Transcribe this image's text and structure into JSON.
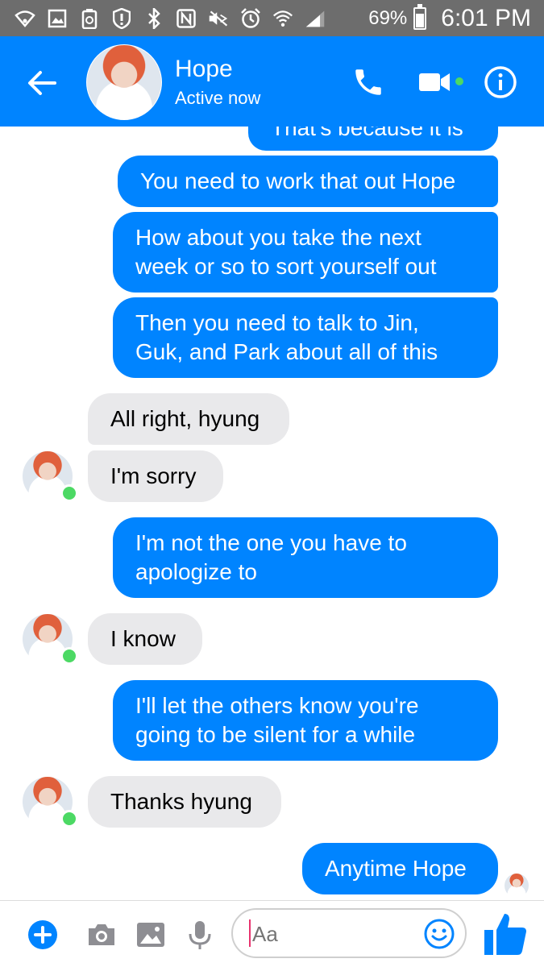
{
  "status_bar": {
    "battery_percent": "69%",
    "time": "6:01 PM",
    "battery_level": 0.69,
    "icons": [
      "wifi-icon",
      "gallery-icon",
      "recycle-icon",
      "shield-alert-icon",
      "bluetooth-icon",
      "nfc-icon",
      "mute-icon",
      "alarm-icon",
      "wifi-signal-icon",
      "cell-signal-icon"
    ]
  },
  "header": {
    "contact_name": "Hope",
    "status": "Active now",
    "accent_color": "#0084ff"
  },
  "messages": [
    {
      "dir": "out",
      "text": "That's because it is"
    },
    {
      "dir": "out",
      "text": "You need to work that out Hope"
    },
    {
      "dir": "out",
      "text": "How about you take the next\nweek or so to sort yourself out"
    },
    {
      "dir": "out",
      "text": "Then you need to talk to Jin,\nGuk, and Park about all of this"
    },
    {
      "dir": "in",
      "text": "All right, hyung"
    },
    {
      "dir": "in",
      "text": "I'm sorry"
    },
    {
      "dir": "out",
      "text": "I'm not the one you have to\napologize to"
    },
    {
      "dir": "in",
      "text": "I know"
    },
    {
      "dir": "out",
      "text": "I'll let the others know you're\ngoing to be silent for a while"
    },
    {
      "dir": "in",
      "text": "Thanks hyung"
    },
    {
      "dir": "out",
      "text": "Anytime Hope"
    }
  ],
  "composer": {
    "placeholder": "Aa",
    "icons": [
      "plus-icon",
      "camera-icon",
      "image-icon",
      "microphone-icon",
      "emoji-icon",
      "thumbs-up-icon"
    ]
  }
}
